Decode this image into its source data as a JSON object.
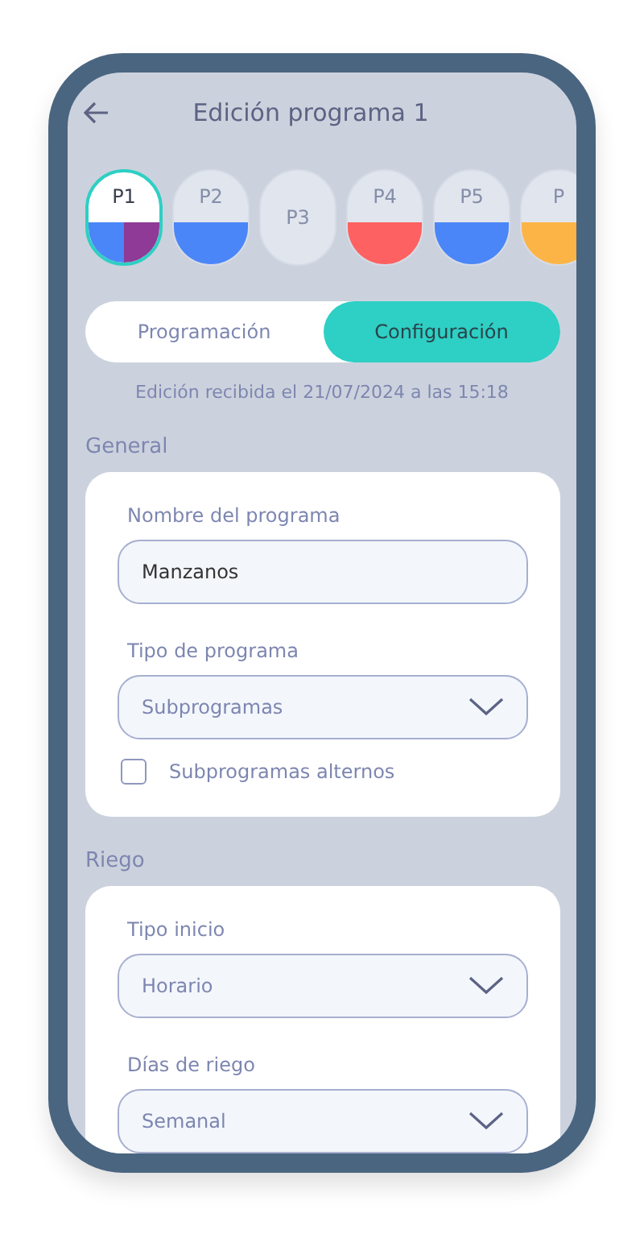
{
  "header": {
    "title": "Edición programa 1"
  },
  "programs": [
    {
      "label": "P1",
      "selected": true,
      "segments": [
        {
          "color": "#4a86f7"
        },
        {
          "color": "#8e3a96"
        }
      ]
    },
    {
      "label": "P2",
      "selected": false,
      "segments": [
        {
          "color": "#4a86f7"
        }
      ]
    },
    {
      "label": "P3",
      "selected": false
    },
    {
      "label": "P4",
      "selected": false,
      "segments": [
        {
          "color": "#fd6161"
        }
      ]
    },
    {
      "label": "P5",
      "selected": false,
      "segments": [
        {
          "color": "#4a86f7"
        }
      ]
    },
    {
      "label": "P",
      "selected": false,
      "segments": [
        {
          "color": "#fdb446"
        }
      ]
    }
  ],
  "tabs": [
    {
      "label": "Programación",
      "selected": false
    },
    {
      "label": "Configuración",
      "selected": true
    }
  ],
  "last_edit": "Edición recibida el 21/07/2024 a las 15:18",
  "sections": [
    {
      "title": "General",
      "fields": [
        {
          "kind": "text",
          "label": "Nombre del programa",
          "value": "Manzanos"
        },
        {
          "kind": "select",
          "label": "Tipo de programa",
          "value": "Subprogramas"
        },
        {
          "kind": "checkbox",
          "label": "Subprogramas alternos",
          "checked": false
        }
      ]
    },
    {
      "title": "Riego",
      "fields": [
        {
          "kind": "select",
          "label": "Tipo inicio",
          "value": "Horario"
        },
        {
          "kind": "select",
          "label": "Días de riego",
          "value": "Semanal"
        }
      ]
    }
  ]
}
